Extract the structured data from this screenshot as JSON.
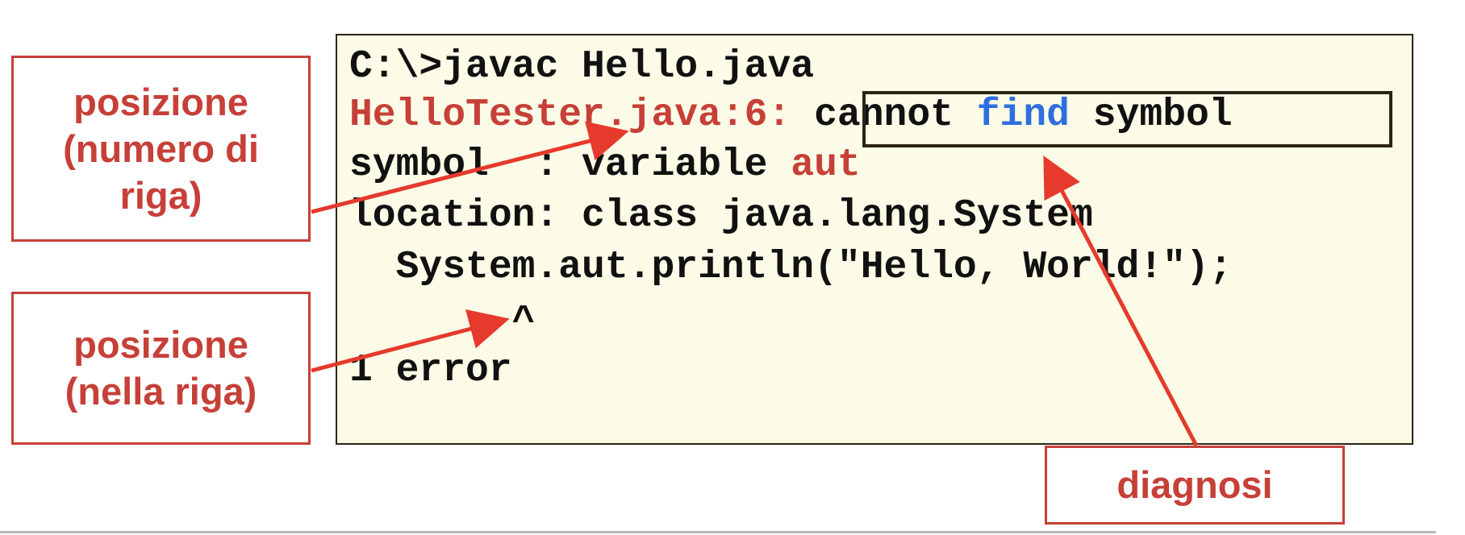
{
  "terminal": {
    "line1": "C:\\>javac Hello.java",
    "line2_prefix": "HelloTester.java:6:",
    "line2_msg_a": "cannot ",
    "line2_msg_keyword": "find",
    "line2_msg_b": " symbol",
    "line3_prefix": "symbol  : variable ",
    "line3_var": "aut",
    "line4": "location: class java.lang.System",
    "line5": "  System.aut.println(\"Hello, World!\");",
    "line6": "       ^",
    "line7": "1 error"
  },
  "labels": {
    "line_number": "posizione\n(numero di\nriga)",
    "in_line": "posizione\n(nella riga)",
    "diagnosis": "diagnosi"
  },
  "colors": {
    "accent_red": "#c64038",
    "keyword_blue": "#2e6fe0",
    "terminal_bg": "#fcfbe7"
  }
}
